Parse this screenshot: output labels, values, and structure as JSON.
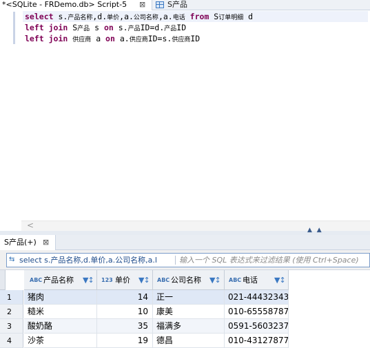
{
  "editor_tabs": {
    "active_label": "*<SQLite - FRDemo.db> Script-5",
    "active_close": "⊠",
    "inactive_label": "S产品"
  },
  "sql": {
    "line1": [
      {
        "t": "select",
        "kw": true
      },
      {
        "t": " s."
      },
      {
        "t": "产品名称",
        "cj": true
      },
      {
        "t": ",d."
      },
      {
        "t": "单价",
        "cj": true
      },
      {
        "t": ",a."
      },
      {
        "t": "公司名称",
        "cj": true
      },
      {
        "t": ",a."
      },
      {
        "t": "电话",
        "cj": true
      },
      {
        "t": " "
      },
      {
        "t": "from",
        "kw": true
      },
      {
        "t": " S"
      },
      {
        "t": "订单明细",
        "cj": true
      },
      {
        "t": " d"
      }
    ],
    "line2": [
      {
        "t": "left join",
        "kw": true
      },
      {
        "t": " S"
      },
      {
        "t": "产品",
        "cj": true
      },
      {
        "t": " s "
      },
      {
        "t": "on",
        "kw": true
      },
      {
        "t": " s."
      },
      {
        "t": "产品",
        "cj": true
      },
      {
        "t": "ID=d."
      },
      {
        "t": "产品",
        "cj": true
      },
      {
        "t": "ID"
      }
    ],
    "line3": [
      {
        "t": "left join",
        "kw": true
      },
      {
        "t": " "
      },
      {
        "t": "供应商",
        "cj": true
      },
      {
        "t": " a "
      },
      {
        "t": "on",
        "kw": true
      },
      {
        "t": " a."
      },
      {
        "t": "供应商",
        "cj": true
      },
      {
        "t": "ID=s."
      },
      {
        "t": "供应商",
        "cj": true
      },
      {
        "t": "ID"
      }
    ]
  },
  "scroll_arrow": "<",
  "splitter_arrows": "▲ ▲",
  "result_tab": {
    "label": "S产品(+)",
    "close": "⊠"
  },
  "filter": {
    "icon": "⇆",
    "query": "select s.产品名称,d.单价,a.公司名称,a.l",
    "placeholder": "输入一个 SQL 表达式来过滤结果 (使用 Ctrl+Space)"
  },
  "columns": [
    {
      "type_tag": "ABC",
      "name": "产品名称"
    },
    {
      "type_tag": "123",
      "name": "单价"
    },
    {
      "type_tag": "ABC",
      "name": "公司名称"
    },
    {
      "type_tag": "ABC",
      "name": "电话"
    }
  ],
  "sort_icon": "▼↕",
  "rows": [
    {
      "num": "1",
      "product": "猪肉",
      "price": "14",
      "company": "正一",
      "phone": "021-44432343"
    },
    {
      "num": "2",
      "product": "糙米",
      "price": "10",
      "company": "康美",
      "phone": "010-65558787"
    },
    {
      "num": "3",
      "product": "酸奶酪",
      "price": "35",
      "company": "福满多",
      "phone": "0591-5603237"
    },
    {
      "num": "4",
      "product": "沙茶",
      "price": "19",
      "company": "德昌",
      "phone": "010-43127877"
    }
  ]
}
